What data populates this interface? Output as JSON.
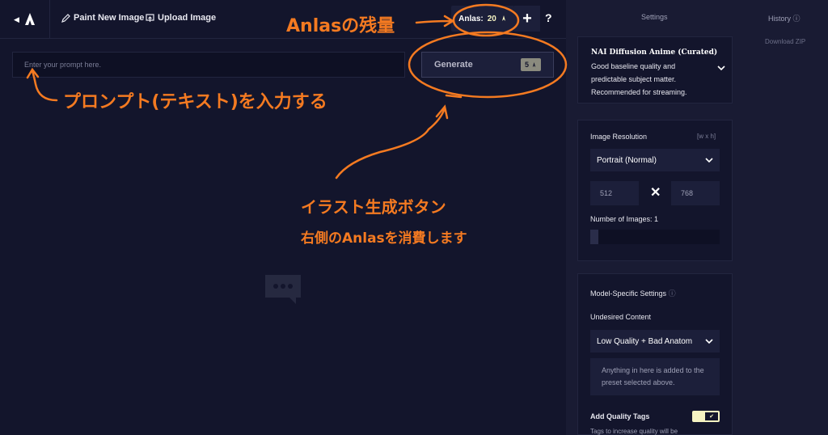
{
  "toolbar": {
    "paint_label": "Paint New Image",
    "upload_label": "Upload Image",
    "anlas_label": "Anlas:",
    "anlas_value": "20",
    "plus": "+",
    "help": "?"
  },
  "prompt": {
    "placeholder": "Enter your prompt here."
  },
  "generate": {
    "label": "Generate",
    "cost": "5"
  },
  "tabs": {
    "settings": "Settings",
    "history": "History",
    "history_info": "ⓘ",
    "download": "Download ZIP"
  },
  "model": {
    "name": "NAI Diffusion Anime (Curated)",
    "description": "Good baseline quality and predictable subject matter. Recommended for streaming."
  },
  "resolution": {
    "label": "Image Resolution",
    "hint": "[w x h]",
    "preset": "Portrait (Normal)",
    "width": "512",
    "height": "768",
    "count_label": "Number of Images:",
    "count_value": "1",
    "images_fraction": 0.0
  },
  "model_settings": {
    "title": "Model-Specific Settings",
    "info": "ⓘ",
    "undesired_label": "Undesired Content",
    "undesired_value": "Low Quality + Bad Anatom",
    "undesired_placeholder": "Anything in here is added to the preset selected above.",
    "quality_tags_label": "Add Quality Tags",
    "quality_tags_on": true,
    "quality_tags_desc": "Tags to increase quality will be"
  },
  "annotations": {
    "anlas": "Anlasの残量",
    "prompt": "プロンプト(テキスト)を入力する",
    "generate_line1": "イラスト生成ボタン",
    "generate_line2": "右側のAnlasを消費します"
  },
  "colors": {
    "accent": "#f47a21",
    "anlas": "#f5f3c2",
    "bg": "#13152c",
    "panel": "#191b33"
  }
}
